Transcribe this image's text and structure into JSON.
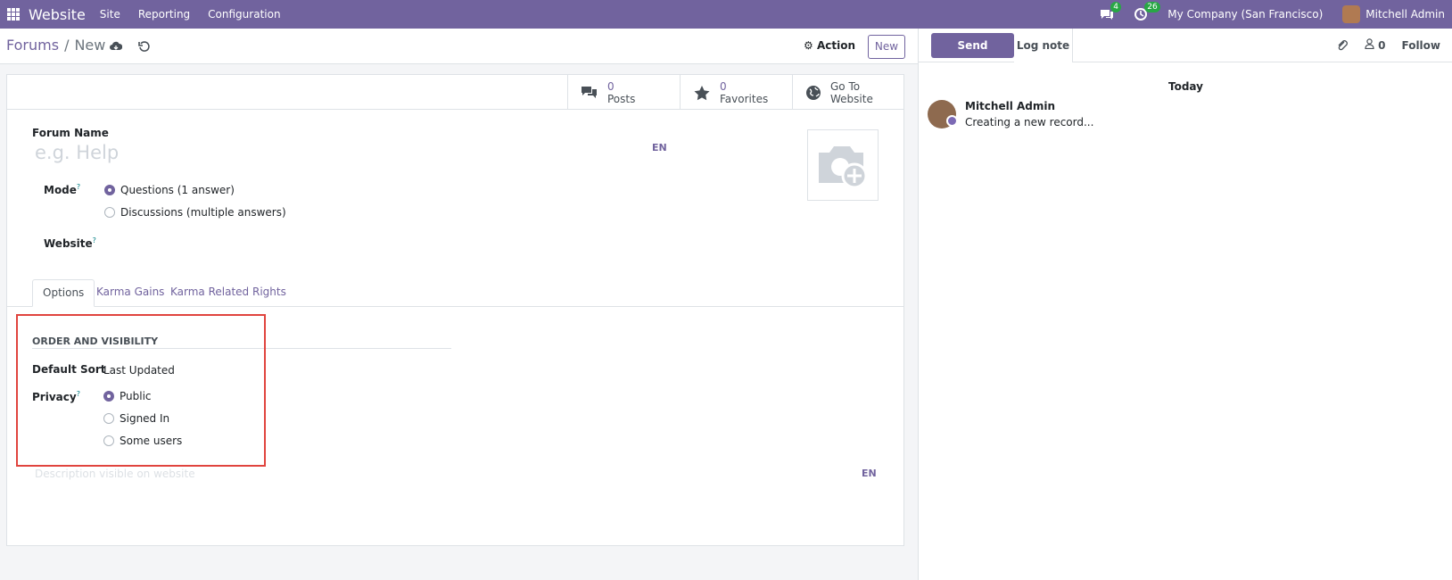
{
  "navbar": {
    "app_name": "Website",
    "menu": [
      "Site",
      "Reporting",
      "Configuration"
    ],
    "messages_count": "4",
    "activities_count": "26",
    "company": "My Company (San Francisco)",
    "user_name": "Mitchell Admin"
  },
  "control": {
    "breadcrumb_parent": "Forums",
    "breadcrumb_separator": "/",
    "breadcrumb_current": "New",
    "action_label": "Action",
    "new_label": "New"
  },
  "stats": [
    {
      "value": "0",
      "label": "Posts",
      "icon": "comments-icon"
    },
    {
      "value": "0",
      "label": "Favorites",
      "icon": "star-icon"
    },
    {
      "value": "Go To",
      "label": "Website",
      "icon": "globe-icon"
    }
  ],
  "form": {
    "forum_name_label": "Forum Name",
    "forum_name_placeholder": "e.g. Help",
    "lang": "EN",
    "mode_label": "Mode",
    "mode_options": [
      {
        "label": "Questions (1 answer)",
        "checked": true
      },
      {
        "label": "Discussions (multiple answers)",
        "checked": false
      }
    ],
    "website_label": "Website",
    "help_mark": "?"
  },
  "tabs": [
    "Options",
    "Karma Gains",
    "Karma Related Rights"
  ],
  "options": {
    "section_title": "ORDER AND VISIBILITY",
    "default_sort_label": "Default Sort",
    "default_sort_value": "Last Updated",
    "privacy_label": "Privacy",
    "privacy_options": [
      {
        "label": "Public",
        "checked": true
      },
      {
        "label": "Signed In",
        "checked": false
      },
      {
        "label": "Some users",
        "checked": false
      }
    ],
    "description_placeholder": "Description visible on website",
    "description_lang": "EN"
  },
  "chatter": {
    "send_message": "Send message",
    "log_note": "Log note",
    "followers_count": "0",
    "follow": "Follow",
    "date_separator": "Today",
    "message_author": "Mitchell Admin",
    "message_body": "Creating a new record..."
  },
  "colors": {
    "brand": "#71639e",
    "highlight": "#e0443e",
    "badge": "#28a745"
  }
}
